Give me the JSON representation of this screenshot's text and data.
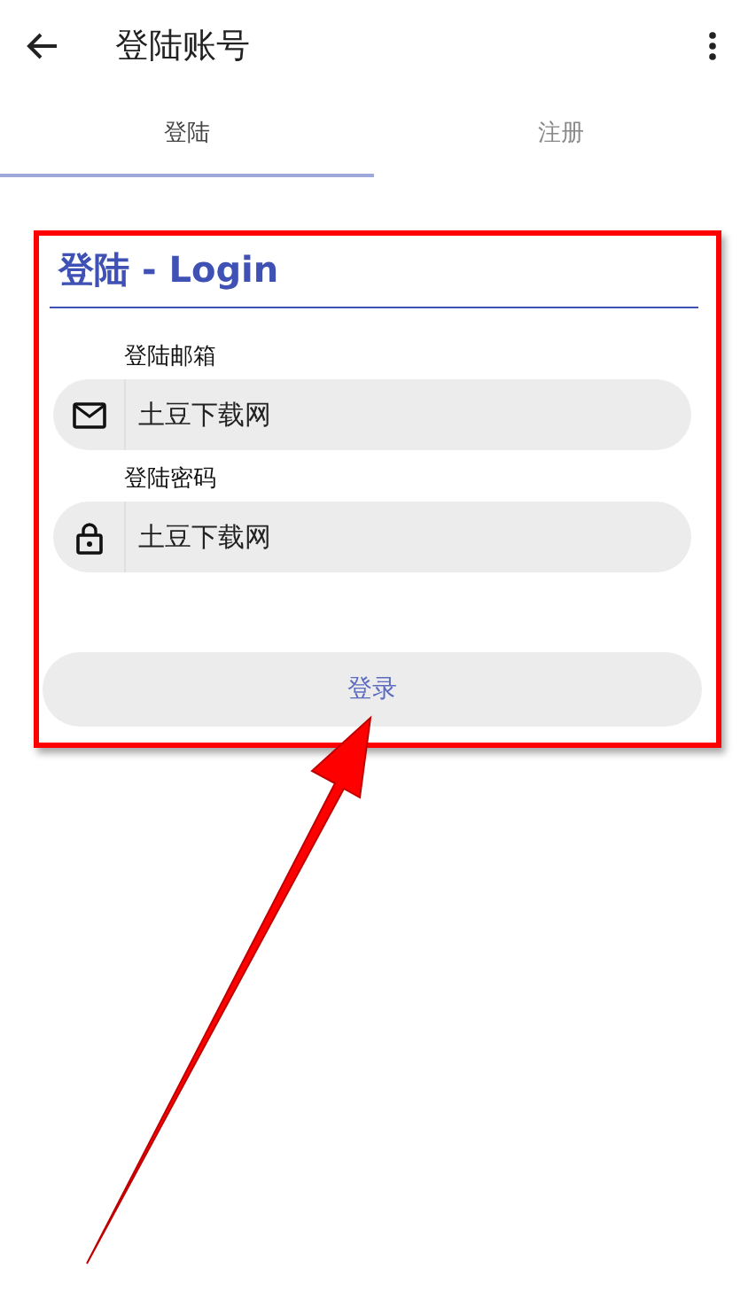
{
  "app_bar": {
    "title": "登陆账号"
  },
  "tabs": [
    {
      "label": "登陆",
      "selected": true
    },
    {
      "label": "注册",
      "selected": false
    }
  ],
  "form": {
    "title": "登陆 - Login",
    "fields": [
      {
        "kind": "email",
        "label": "登陆邮箱",
        "value": "土豆下载网"
      },
      {
        "kind": "password",
        "label": "登陆密码",
        "value": "土豆下载网"
      }
    ],
    "submit": "登录"
  },
  "annotation": {
    "highlight_box": true,
    "arrow": true
  }
}
